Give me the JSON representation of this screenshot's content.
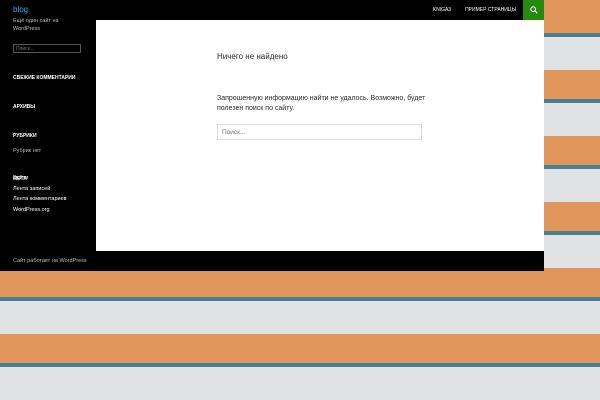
{
  "header": {
    "site_title": "blog",
    "nav": [
      "KNIGA3",
      "Пример страницы"
    ]
  },
  "sidebar": {
    "tagline": "Ещё один сайт на WordPress",
    "search_placeholder": "Поиск...",
    "widgets": {
      "recent_comments": "Свежие комментарии",
      "archives": "Архивы",
      "categories": "Рубрики",
      "categories_text": "Рубрик нет",
      "meta": "Мета",
      "meta_links": [
        "Войти",
        "Лента записей",
        "Лента комментариев",
        "WordPress.org"
      ]
    }
  },
  "content": {
    "title": "Ничего не найдено",
    "text": "Запрошенную информацию найти не удалось. Возможно, будет полезен поиск по сайту.",
    "search_placeholder": "Поиск..."
  },
  "footer": {
    "text": "Сайт работает на WordPress"
  },
  "colors": {
    "accent": "#24890d",
    "link": "#29aae1",
    "stripe_orange": "#e0955a",
    "stripe_blue": "#4a7e93",
    "stripe_gray": "#e1e2e3"
  }
}
